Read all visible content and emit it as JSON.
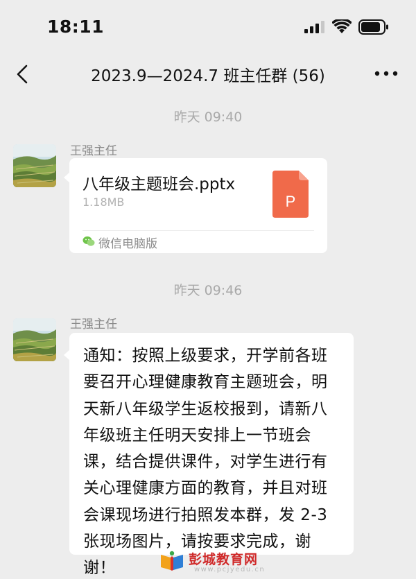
{
  "status_bar": {
    "time": "18:11",
    "icons": [
      "signal-icon",
      "wifi-icon",
      "battery-icon"
    ]
  },
  "nav": {
    "title": "2023.9—2024.7 班主任群 (56)",
    "back_icon": "back-chevron-icon",
    "more_icon": "more-options-icon"
  },
  "messages": [
    {
      "timestamp": "昨天 09:40",
      "sender": "王强主任",
      "type": "file",
      "file_name": "八年级主题班会.pptx",
      "file_size": "1.18MB",
      "file_icon": "ppt-file-icon",
      "file_icon_letter": "P",
      "source": "微信电脑版"
    },
    {
      "timestamp": "昨天 09:46",
      "sender": "王强主任",
      "type": "text",
      "text": "通知：按照上级要求，开学前各班要召开心理健康教育主题班会，明天新八年级学生返校报到，请新八年级班主任明天安排上一节班会课，结合提供课件，对学生进行有关心理健康方面的教育，并且对班会课现场进行拍照发本群，发 2-3张现场图片，请按要求完成，谢谢！"
    }
  ],
  "watermark": {
    "title": "彭城教育网",
    "url": "www.pcjyedu.cn"
  },
  "colors": {
    "background": "#ededed",
    "bubble": "#ffffff",
    "ppt_orange": "#f06a4a",
    "timestamp_gray": "#a9a9a9",
    "wechat_green": "#6fc44a"
  }
}
